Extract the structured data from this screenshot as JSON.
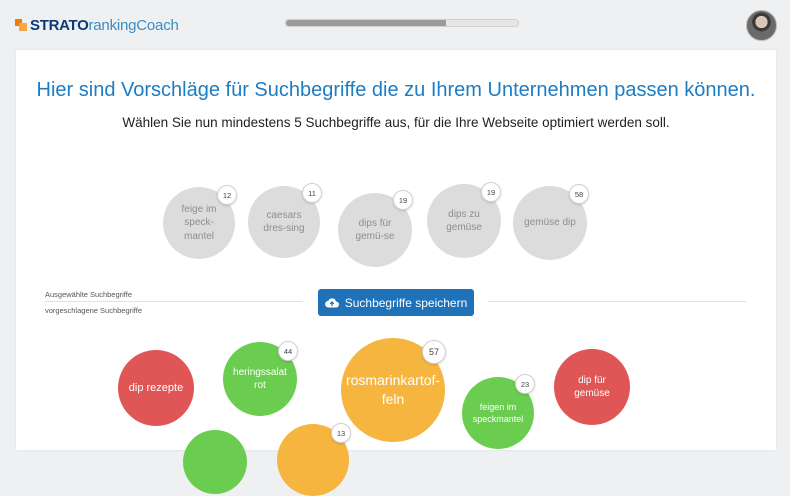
{
  "header": {
    "logo_strato": "STRATO",
    "logo_product": "rankingCoach",
    "progress_fraction": 0.69
  },
  "main": {
    "title": "Hier sind Vorschläge für Suchbegriffe die zu Ihrem Unternehmen passen können.",
    "subtitle": "Wählen Sie nun mindestens 5 Suchbegriffe aus, für die Ihre Webseite optimiert werden soll.",
    "selected_label": "Ausgewählte Suchbegriffe",
    "suggested_label": "vorgeschlagene Suchbegriffe",
    "save_button": "Suchbegriffe speichern"
  },
  "selected": [
    {
      "text": "feige im speck-mantel",
      "count": "12"
    },
    {
      "text": "caesars dres-sing",
      "count": "11"
    },
    {
      "text": "dips für gemü-se",
      "count": "19"
    },
    {
      "text": "dips zu gemüse",
      "count": "19"
    },
    {
      "text": "gemüse dip",
      "count": "58"
    }
  ],
  "suggested": [
    {
      "text": "dip rezepte",
      "count": ""
    },
    {
      "text": "heringssalat rot",
      "count": "44"
    },
    {
      "text": "rosmarinkartof-feln",
      "count": "57"
    },
    {
      "text": "feigen im speckmantel",
      "count": "23"
    },
    {
      "text": "dip für gemüse",
      "count": ""
    },
    {
      "text": "",
      "count": "13"
    }
  ],
  "colors": {
    "accent": "#1c7dc4",
    "button": "#1f72b8",
    "red": "#e05656",
    "green": "#6acd4f",
    "orange": "#f6b53f",
    "grey": "#dcdcdc"
  }
}
